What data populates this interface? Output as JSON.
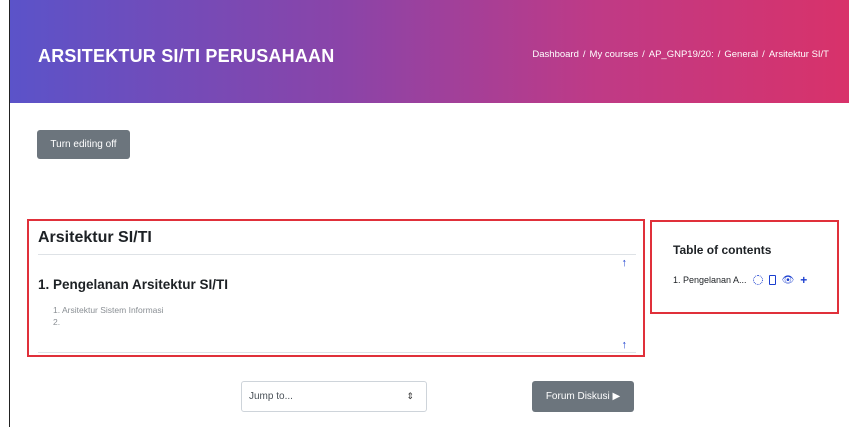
{
  "header": {
    "course_title": "ARSITEKTUR SI/TI PERUSAHAAN",
    "breadcrumb": [
      "Dashboard",
      "My courses",
      "AP_GNP19/20:",
      "General",
      "Arsitektur SI/T"
    ],
    "breadcrumb_separator": "/"
  },
  "toolbar": {
    "edit_toggle_label": "Turn editing off"
  },
  "main": {
    "section_title": "Arsitektur SI/TI",
    "subsection_title": "1. Pengelanan Arsitektur SI/TI",
    "items": [
      "1. Arsitektur Sistem Informasi",
      "2."
    ],
    "arrow_icon": "↑"
  },
  "sidebar": {
    "title": "Table of contents",
    "entry": "1. Pengelanan A...",
    "icons": [
      "gear-icon",
      "document-icon",
      "eye-icon",
      "plus-icon"
    ]
  },
  "footer": {
    "jump_placeholder": "Jump to...",
    "select_caret": "⇕",
    "next_button": "Forum Diskusi ▶"
  },
  "colors": {
    "accent": "#1a3ecf",
    "highlight_border": "#e0303a",
    "button": "#6c757d"
  }
}
